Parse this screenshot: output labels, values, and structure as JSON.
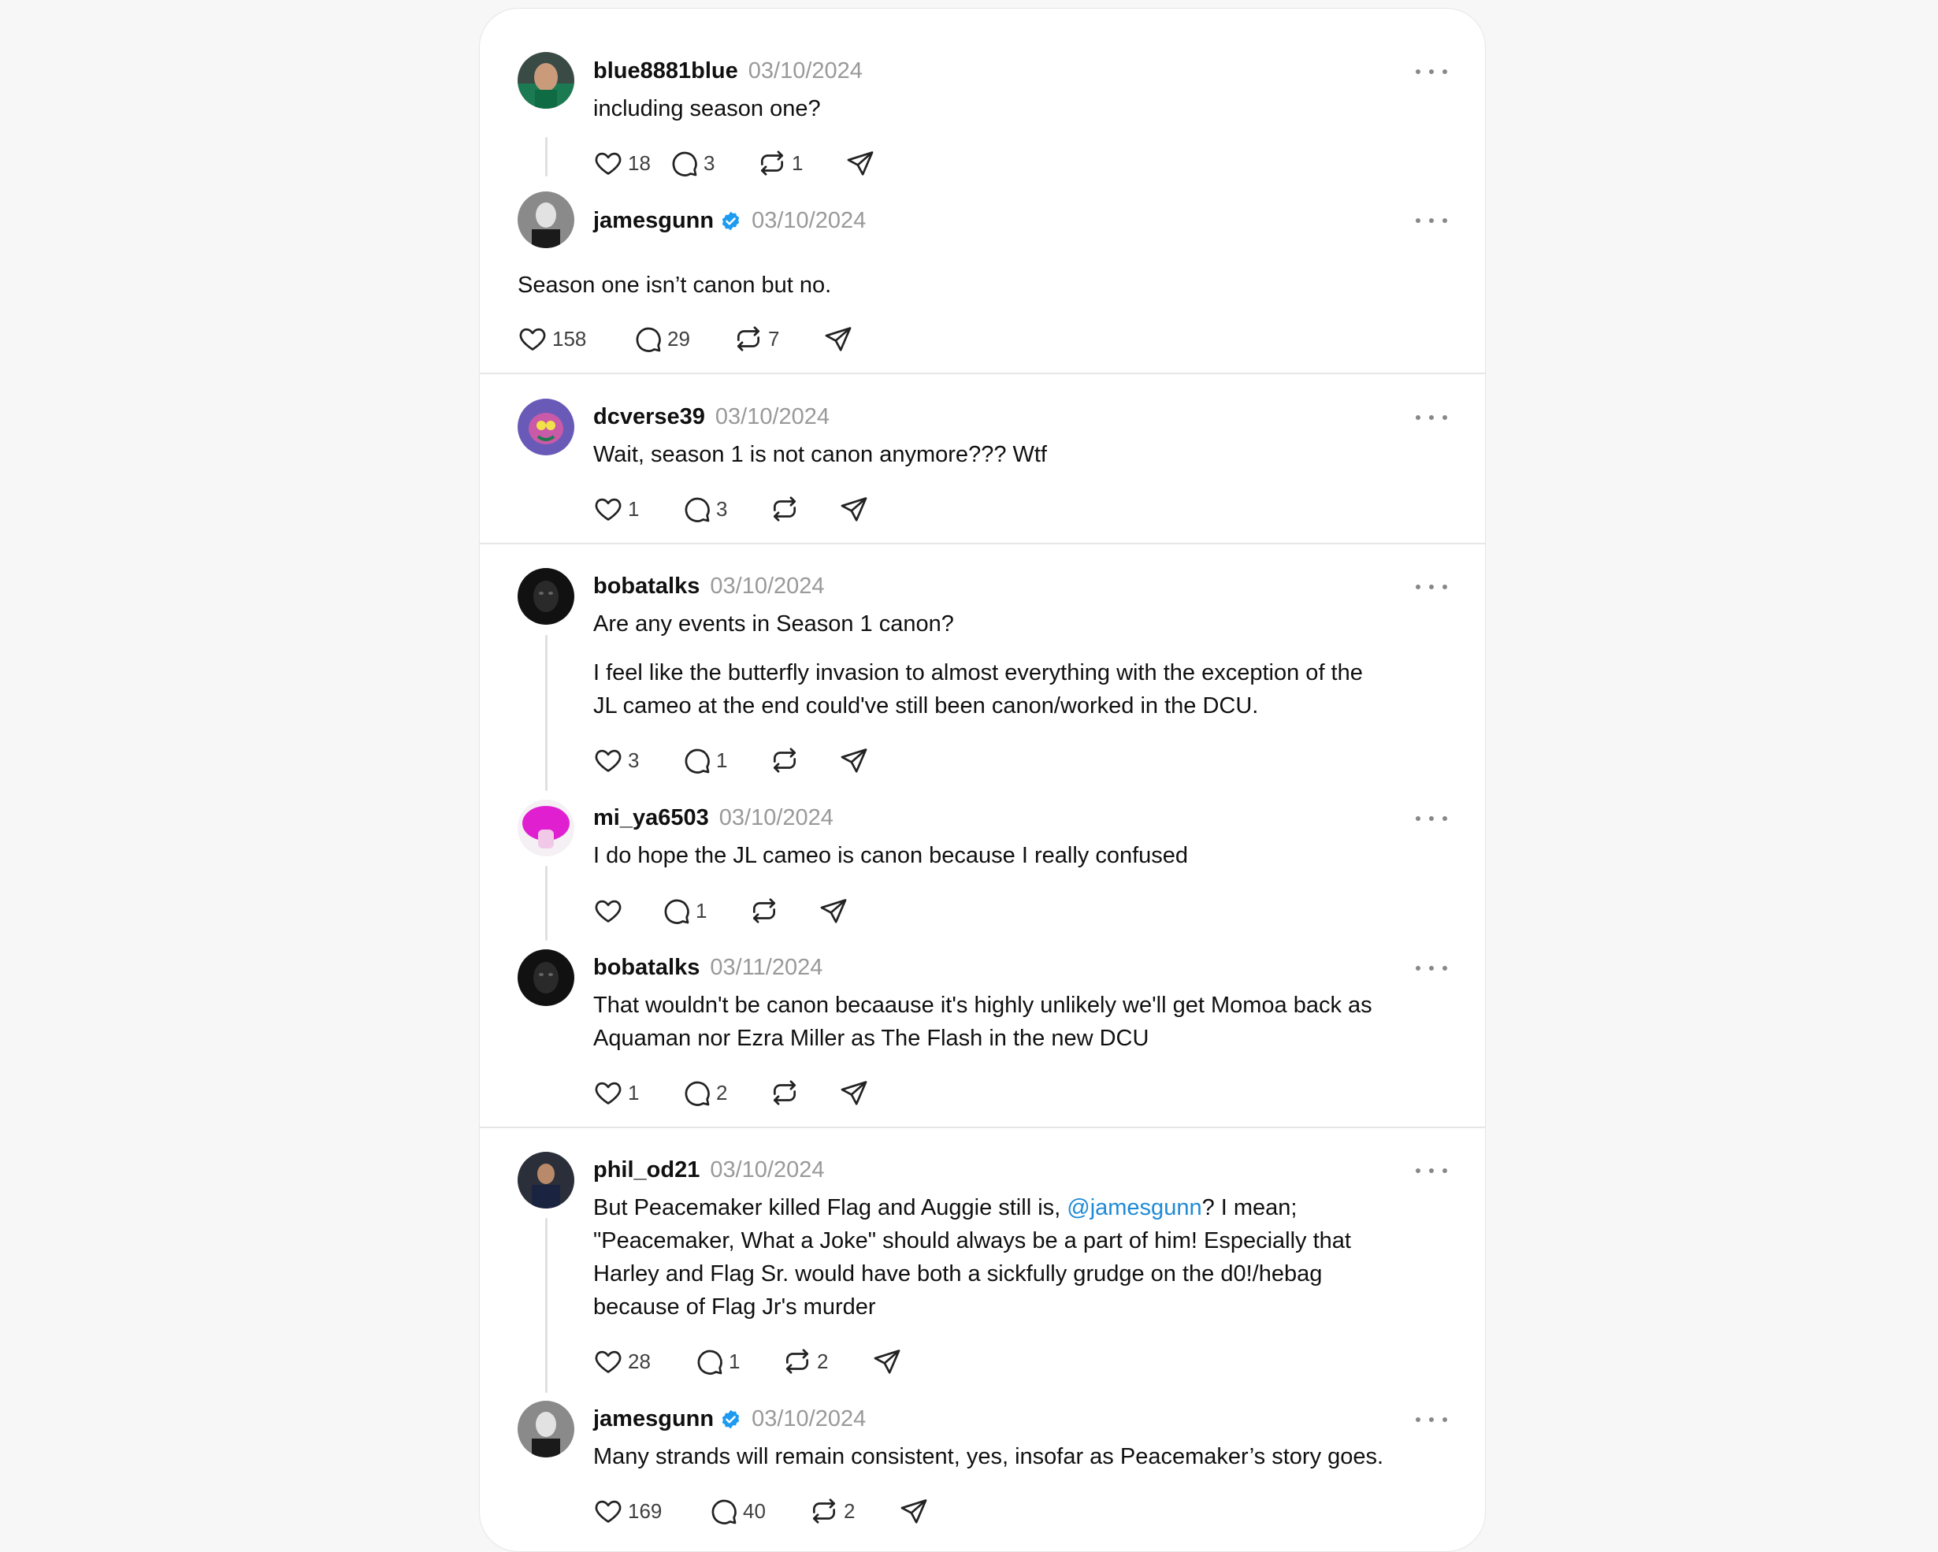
{
  "colors": {
    "mention": "#1f8ad6",
    "verified": "#1d9bf0",
    "muted": "#999999"
  },
  "posts": [
    {
      "username": "blue8881blue",
      "date": "03/10/2024",
      "lines": [
        "including season one?"
      ],
      "likes": "18",
      "replies": "3",
      "reposts": "1"
    },
    {
      "username": "jamesgunn",
      "verified": true,
      "date": "03/10/2024",
      "lines": [
        "Season one isn’t canon but no."
      ],
      "likes": "158",
      "replies": "29",
      "reposts": "7"
    },
    {
      "username": "dcverse39",
      "date": "03/10/2024",
      "lines": [
        "Wait, season 1 is not canon anymore??? Wtf"
      ],
      "likes": "1",
      "replies": "3",
      "reposts": ""
    },
    {
      "username": "bobatalks",
      "date": "03/10/2024",
      "lines": [
        "Are any events in Season 1 canon?",
        "I feel like the butterfly invasion to almost everything with the exception of the",
        "JL cameo at the end could've still been canon/worked in the DCU."
      ],
      "likes": "3",
      "replies": "1",
      "reposts": ""
    },
    {
      "username": "mi_ya6503",
      "date": "03/10/2024",
      "lines": [
        "I do hope the JL cameo is canon because I really confused"
      ],
      "likes": "",
      "replies": "1",
      "reposts": ""
    },
    {
      "username": "bobatalks",
      "date": "03/11/2024",
      "lines": [
        "That wouldn't be canon becaause it's highly unlikely we'll get Momoa back as",
        "Aquaman nor Ezra Miller as The Flash in the new DCU"
      ],
      "likes": "1",
      "replies": "2",
      "reposts": ""
    },
    {
      "username": "phil_od21",
      "date": "03/10/2024",
      "line1_before": "But Peacemaker killed Flag and Auggie still is, ",
      "line1_mention": "@jamesgunn",
      "line1_after": "? I mean;",
      "lines": [
        "\"Peacemaker, What a Joke\" should always be a part of him! Especially that",
        "Harley and Flag Sr. would have both a sickfully grudge on the d0!/hebag",
        "because of Flag Jr's murder"
      ],
      "likes": "28",
      "replies": "1",
      "reposts": "2"
    },
    {
      "username": "jamesgunn",
      "verified": true,
      "date": "03/10/2024",
      "lines": [
        "Many strands will remain consistent, yes, insofar as Peacemaker’s story goes."
      ],
      "likes": "169",
      "replies": "40",
      "reposts": "2"
    }
  ]
}
